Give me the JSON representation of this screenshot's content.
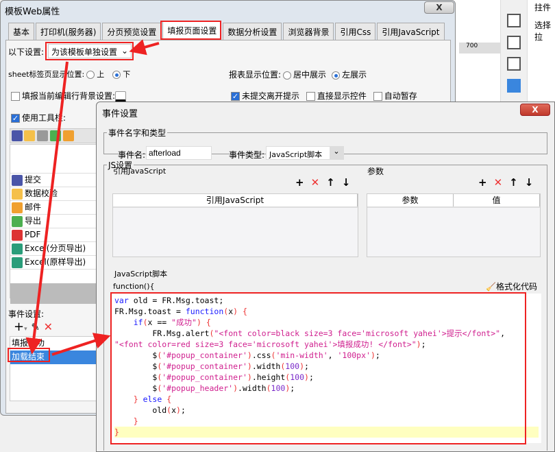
{
  "background": {
    "ruler_mark": "700",
    "side_text_1": "拄件",
    "side_text_2": "选择拉"
  },
  "main_window": {
    "title": "模板Web属性",
    "close": "X",
    "tabs": [
      "基本",
      "打印机(服务器)",
      "分页预览设置",
      "填报页面设置",
      "数据分析设置",
      "浏览器背景",
      "引用Css",
      "引用JavaScript"
    ],
    "active_tab": "填报页面设置",
    "settings_label": "以下设置:",
    "settings_value": "为该模板单独设置",
    "sheet_pos_label": "sheet标签页显示位置:",
    "sheet_pos_options": [
      "上",
      "下"
    ],
    "sheet_pos_selected": "下",
    "report_pos_label": "报表显示位置:",
    "report_pos_options": [
      "居中展示",
      "左展示"
    ],
    "report_pos_selected": "左展示",
    "row_bg_label": "填报当前编辑行背景设置:",
    "checks": [
      {
        "label": "未提交离开提示",
        "checked": true
      },
      {
        "label": "直接显示控件",
        "checked": false
      },
      {
        "label": "自动暂存",
        "checked": false
      }
    ],
    "use_toolbar": {
      "label": "使用工具栏:",
      "checked": true
    },
    "toolbar_items": [
      "提交",
      "数据校验",
      "邮件",
      "导出",
      "PDF",
      "Excel(分页导出)",
      "Excel(原样导出)"
    ],
    "event_label": "事件设置:",
    "events": [
      "填报成功",
      "加载结束"
    ],
    "selected_event": "加载结束"
  },
  "event_dialog": {
    "title": "事件设置",
    "close": "X",
    "name_type_legend": "事件名字和类型",
    "name_label": "事件名:",
    "name_value": "afterload",
    "type_label": "事件类型:",
    "type_value": "JavaScript脚本",
    "js_legend": "JS设置",
    "ref_js_label": "引用JavaScript",
    "ref_js_column": "引用JavaScript",
    "params_label": "参数",
    "params_columns": [
      "参数",
      "值"
    ],
    "script_label": "JavaScript脚本",
    "function_header": "function(){",
    "format_button": "格式化代码",
    "code_lines": [
      "var old = FR.Msg.toast;",
      "FR.Msg.toast = function(x) {",
      "    if(x == \"成功\") {",
      "        FR.Msg.alert(\"<font color=black size=3 face='microsoft yahei'>提示</font>\",",
      "\"<font color=red size=3 face='microsoft yahei'>填报成功! </font>\");",
      "        $('#popup_container').css('min-width', '100px');",
      "        $('#popup_container').width(100);",
      "        $('#popup_container').height(100);",
      "        $('#popup_header').width(100);",
      "    } else {",
      "        old(x);",
      "    }",
      "}"
    ]
  },
  "colors": {
    "highlight": "#ee2222",
    "selection": "#3a86de",
    "keyword": "#1a1aff",
    "string": "#d0208f"
  }
}
